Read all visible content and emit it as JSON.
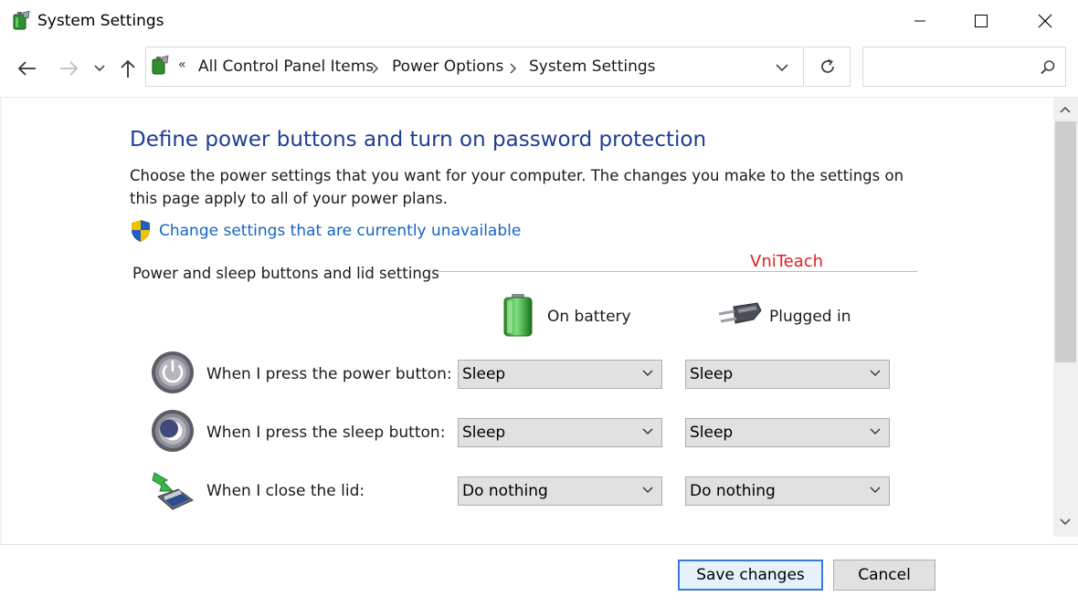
{
  "window": {
    "title": "System Settings"
  },
  "nav": {
    "breadcrumb_prefix": "«",
    "breadcrumbs": [
      "All Control Panel Items",
      "Power Options",
      "System Settings"
    ],
    "search_placeholder": ""
  },
  "content": {
    "heading": "Define power buttons and turn on password protection",
    "description": "Choose the power settings that you want for your computer. The changes you make to the settings on this page apply to all of your power plans.",
    "change_link": "Change settings that are currently unavailable",
    "section_label": "Power and sleep buttons and lid settings",
    "watermark": "VniTeach",
    "columns": {
      "battery": "On battery",
      "plugged": "Plugged in"
    },
    "rows": [
      {
        "label": "When I press the power button:",
        "battery": "Sleep",
        "plugged": "Sleep"
      },
      {
        "label": "When I press the sleep button:",
        "battery": "Sleep",
        "plugged": "Sleep"
      },
      {
        "label": "When I close the lid:",
        "battery": "Do nothing",
        "plugged": "Do nothing"
      }
    ]
  },
  "footer": {
    "save_label": "Save changes",
    "cancel_label": "Cancel"
  },
  "colors": {
    "heading": "#1e3d94",
    "link": "#1565c0",
    "watermark": "#e02020",
    "primary_border": "#3c78d8"
  }
}
